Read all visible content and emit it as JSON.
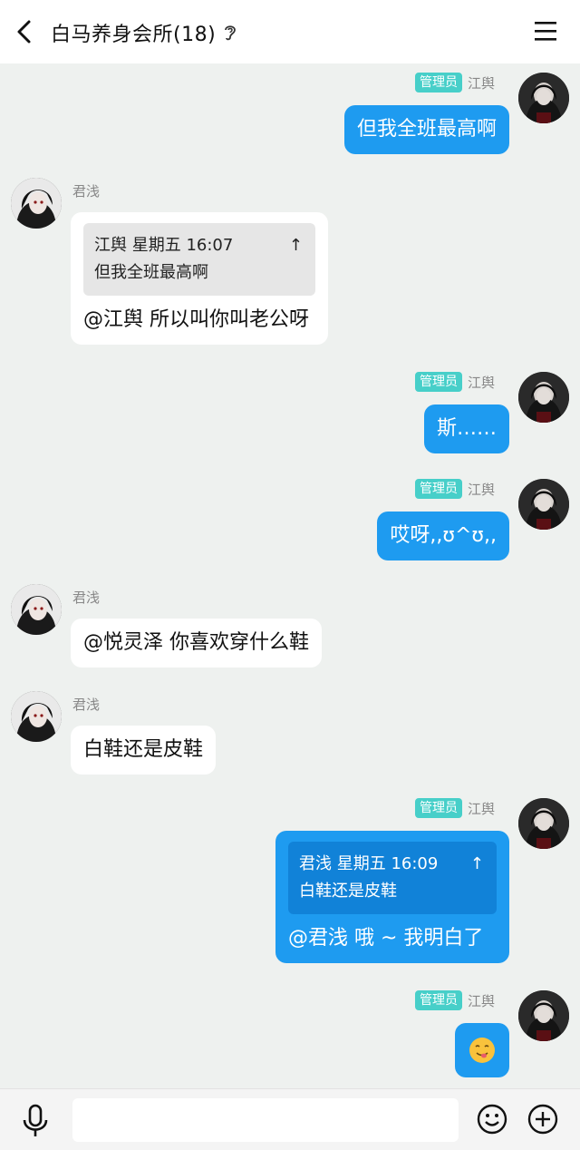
{
  "header": {
    "title": "白马养身会所(18)"
  },
  "roles": {
    "admin_badge": "管理员"
  },
  "messages": [
    {
      "sender": "江舆",
      "side": "right",
      "text": "但我全班最高啊"
    },
    {
      "sender": "君浅",
      "side": "left",
      "quote_header": "江舆 星期五 16:07",
      "quote_body": "但我全班最高啊",
      "quote_jump": "↑",
      "text": "@江舆 所以叫你叫老公呀"
    },
    {
      "sender": "江舆",
      "side": "right",
      "text": "斯……"
    },
    {
      "sender": "江舆",
      "side": "right",
      "text": "哎呀,,ʊ^ʊ,,"
    },
    {
      "sender": "君浅",
      "side": "left",
      "text": "@悦灵泽 你喜欢穿什么鞋"
    },
    {
      "sender": "君浅",
      "side": "left",
      "text": "白鞋还是皮鞋"
    },
    {
      "sender": "江舆",
      "side": "right",
      "quote_header": "君浅 星期五 16:09",
      "quote_body": "白鞋还是皮鞋",
      "quote_jump": "↑",
      "text": "@君浅 哦 ~ 我明白了"
    },
    {
      "sender": "江舆",
      "side": "right",
      "emoji": "smile-tongue-emoji"
    }
  ],
  "footer": {
    "input_placeholder": ""
  },
  "colors": {
    "bubble_me": "#1e9bf0",
    "badge": "#47cfc9",
    "background": "#eef1ef"
  }
}
